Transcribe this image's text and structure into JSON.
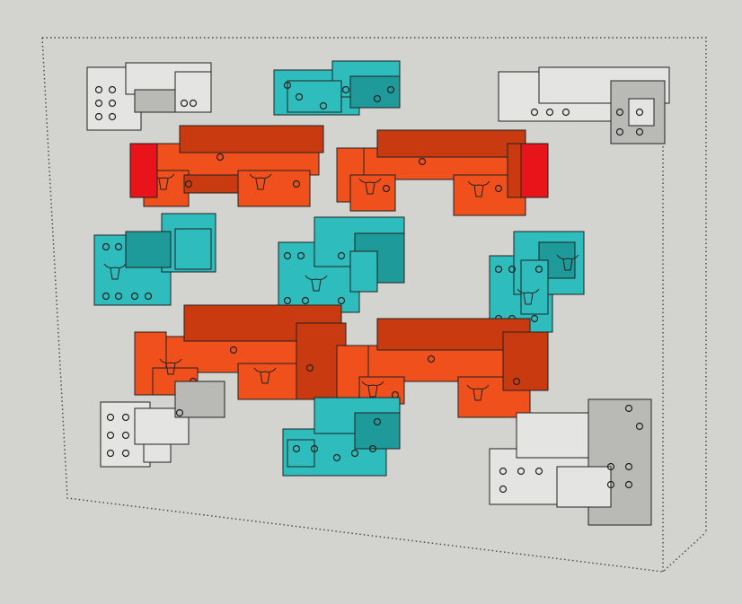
{
  "viewport": {
    "background": "#d3d4cf",
    "colors": {
      "grey_part": "#e4e4e2",
      "grey_shade": "#b9b9b6",
      "cyan_part": "#2fbcbc",
      "cyan_shade": "#1f9a9a",
      "orange_part": "#f0501c",
      "orange_shade": "#c93a10",
      "red_part": "#e8141a",
      "bounding_box": "#444444"
    }
  }
}
